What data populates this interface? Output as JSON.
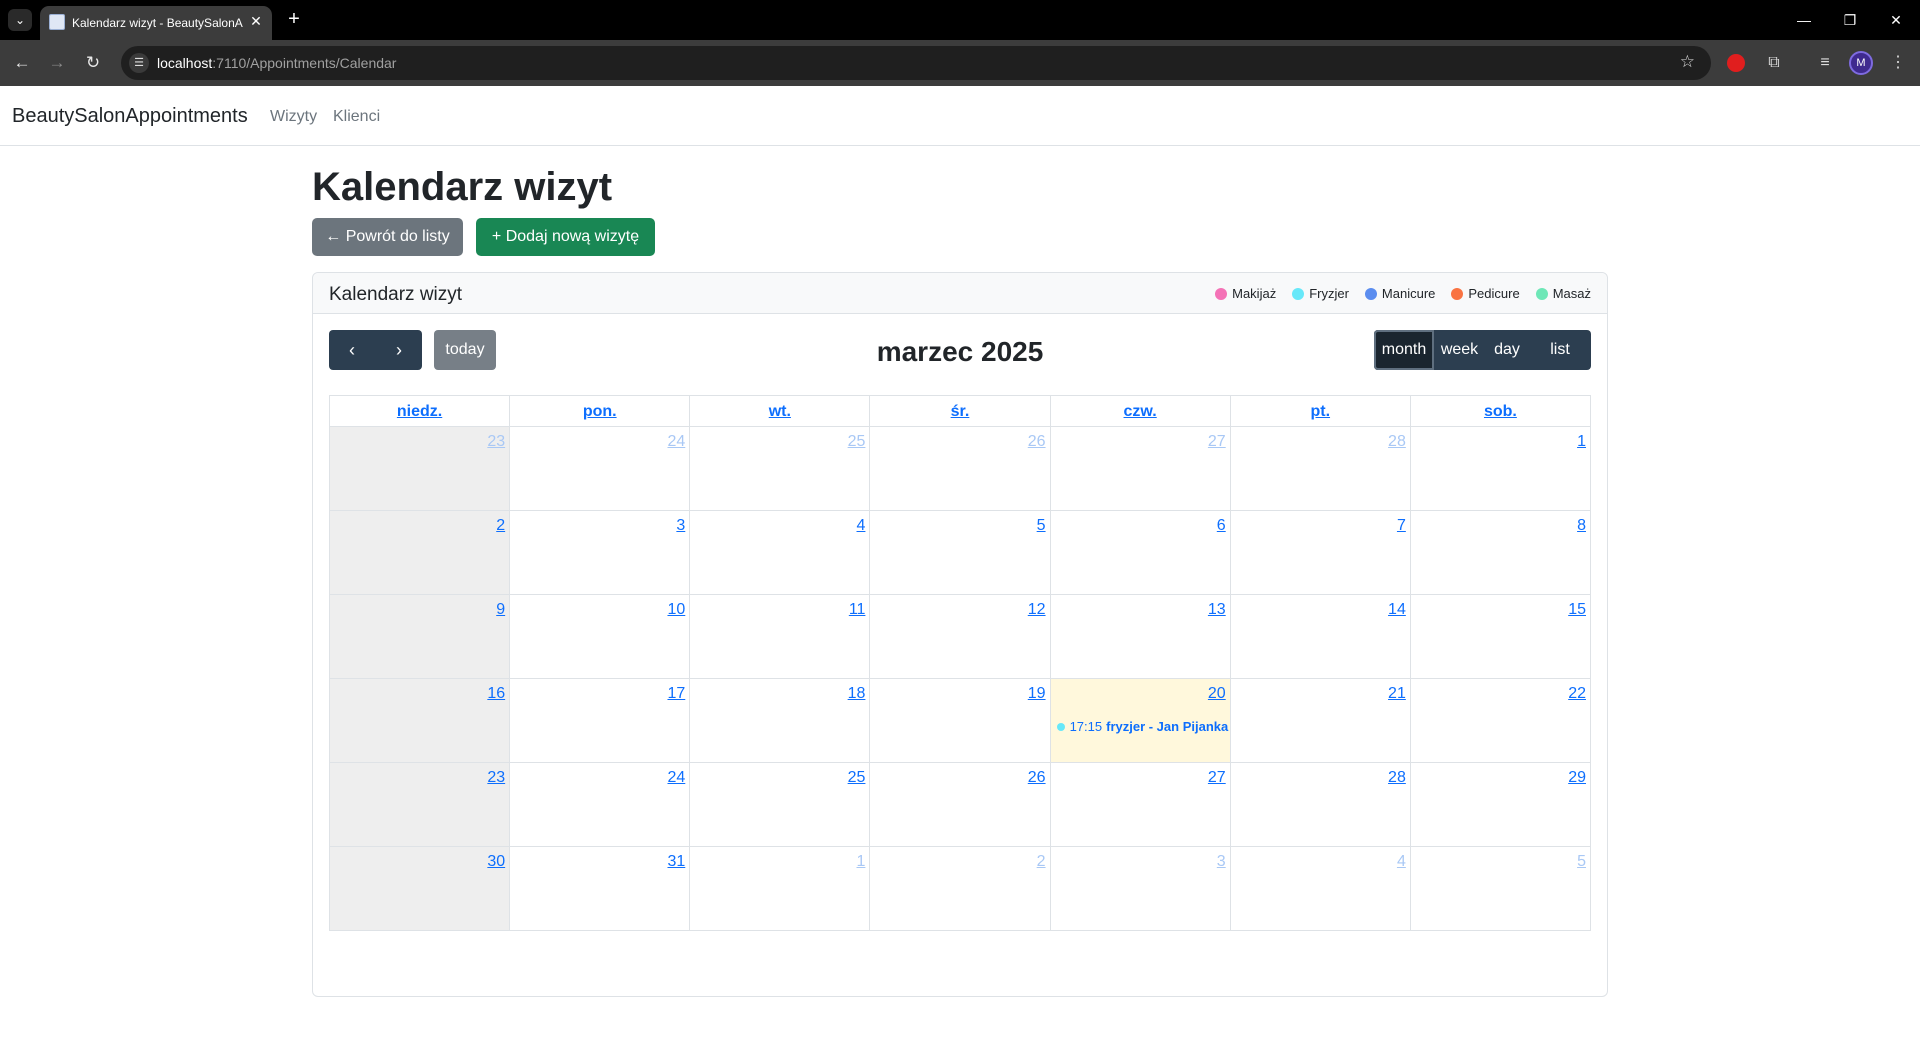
{
  "browser": {
    "tab_title": "Kalendarz wizyt - BeautySalonA",
    "url_host": "localhost",
    "url_rest": ":7110/Appointments/Calendar",
    "avatar_letter": "M"
  },
  "navbar": {
    "brand": "BeautySalonAppointments",
    "links": [
      "Wizyty",
      "Klienci"
    ]
  },
  "page": {
    "title": "Kalendarz wizyt",
    "back_button": "← Powrót do listy",
    "add_button": "+ Dodaj nową wizytę"
  },
  "card": {
    "title": "Kalendarz wizyt",
    "legend": [
      {
        "label": "Makijaż",
        "color": "#f472b6"
      },
      {
        "label": "Fryzjer",
        "color": "#67e8f9"
      },
      {
        "label": "Manicure",
        "color": "#5b8def"
      },
      {
        "label": "Pedicure",
        "color": "#f97342"
      },
      {
        "label": "Masaż",
        "color": "#6ee7b7"
      }
    ]
  },
  "calendar": {
    "today_label": "today",
    "title": "marzec 2025",
    "views": [
      "month",
      "week",
      "day",
      "list"
    ],
    "active_view": "month",
    "day_headers": [
      "niedz.",
      "pon.",
      "wt.",
      "śr.",
      "czw.",
      "pt.",
      "sob."
    ],
    "weeks": [
      [
        {
          "n": "23",
          "other": true
        },
        {
          "n": "24",
          "other": true
        },
        {
          "n": "25",
          "other": true
        },
        {
          "n": "26",
          "other": true
        },
        {
          "n": "27",
          "other": true
        },
        {
          "n": "28",
          "other": true
        },
        {
          "n": "1"
        }
      ],
      [
        {
          "n": "2"
        },
        {
          "n": "3"
        },
        {
          "n": "4"
        },
        {
          "n": "5"
        },
        {
          "n": "6"
        },
        {
          "n": "7"
        },
        {
          "n": "8"
        }
      ],
      [
        {
          "n": "9"
        },
        {
          "n": "10"
        },
        {
          "n": "11"
        },
        {
          "n": "12"
        },
        {
          "n": "13"
        },
        {
          "n": "14"
        },
        {
          "n": "15"
        }
      ],
      [
        {
          "n": "16"
        },
        {
          "n": "17"
        },
        {
          "n": "18"
        },
        {
          "n": "19"
        },
        {
          "n": "20",
          "today": true,
          "event": {
            "time": "17:15",
            "title": "fryzjer - Jan Pijanka",
            "color": "#67e8f9"
          }
        },
        {
          "n": "21"
        },
        {
          "n": "22"
        }
      ],
      [
        {
          "n": "23"
        },
        {
          "n": "24"
        },
        {
          "n": "25"
        },
        {
          "n": "26"
        },
        {
          "n": "27"
        },
        {
          "n": "28"
        },
        {
          "n": "29"
        }
      ],
      [
        {
          "n": "30"
        },
        {
          "n": "31"
        },
        {
          "n": "1",
          "other": true
        },
        {
          "n": "2",
          "other": true
        },
        {
          "n": "3",
          "other": true
        },
        {
          "n": "4",
          "other": true
        },
        {
          "n": "5",
          "other": true
        }
      ]
    ]
  }
}
